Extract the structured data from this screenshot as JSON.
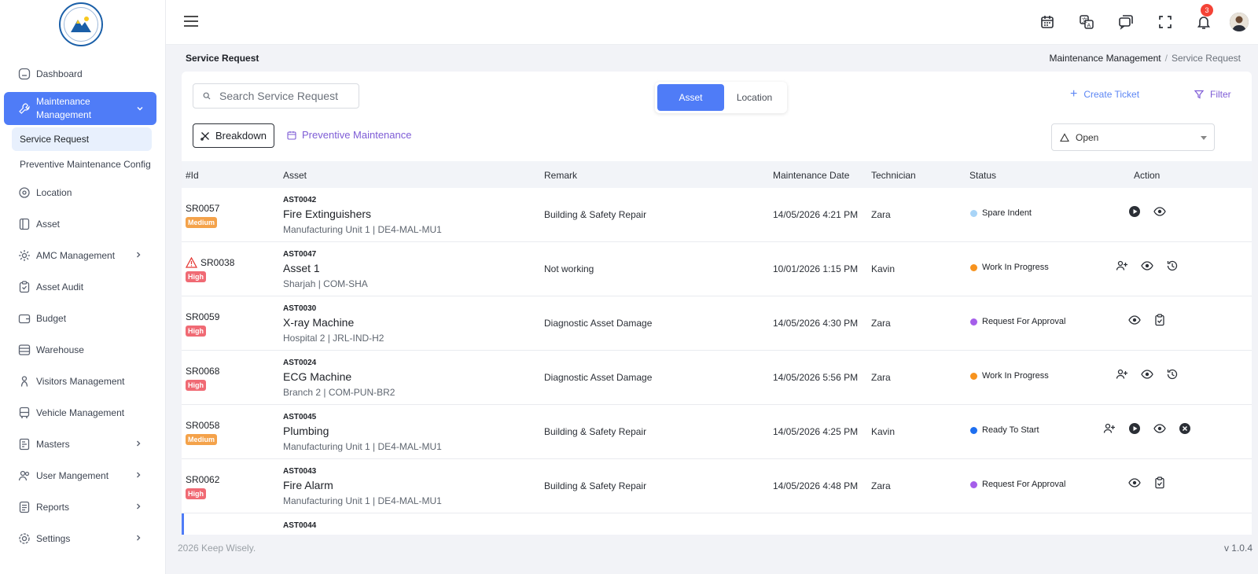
{
  "app": {
    "brand": "KEEP WISELY"
  },
  "sidebar": {
    "items": [
      {
        "label": "Dashboard"
      },
      {
        "label": "Maintenance Management"
      },
      {
        "label": "Service Request"
      },
      {
        "label": "Preventive Maintenance Config"
      },
      {
        "label": "Location"
      },
      {
        "label": "Asset"
      },
      {
        "label": "AMC Management"
      },
      {
        "label": "Asset Audit"
      },
      {
        "label": "Budget"
      },
      {
        "label": "Warehouse"
      },
      {
        "label": "Visitors Management"
      },
      {
        "label": "Vehicle Management"
      },
      {
        "label": "Masters"
      },
      {
        "label": "User Mangement"
      },
      {
        "label": "Reports"
      },
      {
        "label": "Settings"
      }
    ]
  },
  "topbar": {
    "notification_count": "3"
  },
  "page": {
    "title": "Service Request",
    "breadcrumb": {
      "parent": "Maintenance Management",
      "current": "Service Request"
    }
  },
  "toolbar": {
    "search_placeholder": "Search Service Request",
    "toggle": {
      "asset": "Asset",
      "location": "Location"
    },
    "create_ticket": "Create Ticket",
    "filter": "Filter",
    "breakdown": "Breakdown",
    "preventive": "Preventive Maintenance",
    "status_filter": "Open"
  },
  "colors": {
    "primary": "#4f7cf7",
    "purple": "#7e5cd6",
    "priority_high": "#f06a74",
    "priority_medium": "#f4a24a",
    "status_spare_indent": "#a8d4f7",
    "status_work_in_progress": "#f7931e",
    "status_request_for_approval": "#a55eea",
    "status_ready_to_start": "#1e6ff0"
  },
  "table": {
    "headers": {
      "id": "#Id",
      "asset": "Asset",
      "remark": "Remark",
      "date": "Maintenance Date",
      "technician": "Technician",
      "status": "Status",
      "action": "Action"
    },
    "rows": [
      {
        "id": "SR0057",
        "priority": "Medium",
        "asset_code": "AST0042",
        "asset_name": "Fire Extinguishers",
        "location": "Manufacturing Unit 1 | DE4-MAL-MU1",
        "remark": "Building & Safety Repair",
        "date": "14/05/2026 4:21 PM",
        "technician": "Zara",
        "status": "Spare Indent"
      },
      {
        "id": "SR0038",
        "priority": "High",
        "asset_code": "AST0047",
        "asset_name": "Asset 1",
        "location": "Sharjah | COM-SHA",
        "remark": "Not working",
        "date": "10/01/2026 1:15 PM",
        "technician": "Kavin",
        "status": "Work In Progress"
      },
      {
        "id": "SR0059",
        "priority": "High",
        "asset_code": "AST0030",
        "asset_name": "X-ray Machine",
        "location": "Hospital 2 | JRL-IND-H2",
        "remark": "Diagnostic Asset Damage",
        "date": "14/05/2026 4:30 PM",
        "technician": "Zara",
        "status": "Request For Approval"
      },
      {
        "id": "SR0068",
        "priority": "High",
        "asset_code": "AST0024",
        "asset_name": "ECG Machine",
        "location": "Branch 2 | COM-PUN-BR2",
        "remark": "Diagnostic Asset Damage",
        "date": "14/05/2026 5:56 PM",
        "technician": "Zara",
        "status": "Work In Progress"
      },
      {
        "id": "SR0058",
        "priority": "Medium",
        "asset_code": "AST0045",
        "asset_name": "Plumbing",
        "location": "Manufacturing Unit 1 | DE4-MAL-MU1",
        "remark": "Building & Safety Repair",
        "date": "14/05/2026 4:25 PM",
        "technician": "Kavin",
        "status": "Ready To Start"
      },
      {
        "id": "SR0062",
        "priority": "High",
        "asset_code": "AST0043",
        "asset_name": "Fire Alarm",
        "location": "Manufacturing Unit 1 | DE4-MAL-MU1",
        "remark": "Building & Safety Repair",
        "date": "14/05/2026 4:48 PM",
        "technician": "Zara",
        "status": "Request For Approval"
      },
      {
        "asset_code": "AST0044"
      }
    ]
  },
  "footer": {
    "copyright": "2026 Keep Wisely.",
    "version": "v 1.0.4"
  }
}
